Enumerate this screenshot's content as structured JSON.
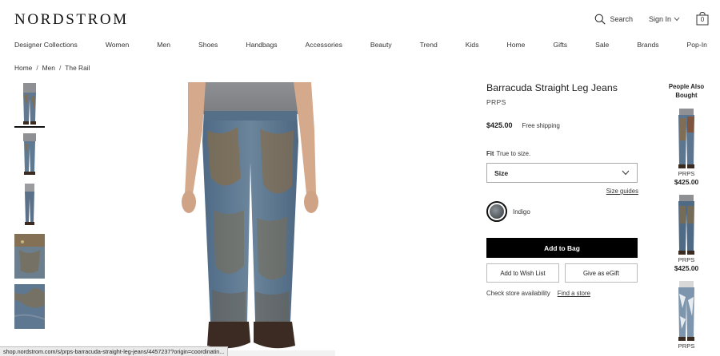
{
  "header": {
    "logo": "NORDSTROM",
    "search_label": "Search",
    "signin_label": "Sign In",
    "bag_count": "0"
  },
  "nav": [
    "Designer Collections",
    "Women",
    "Men",
    "Shoes",
    "Handbags",
    "Accessories",
    "Beauty",
    "Trend",
    "Kids",
    "Home",
    "Gifts",
    "Sale",
    "Brands",
    "Pop-In"
  ],
  "breadcrumb": [
    "Home",
    "Men",
    "The Rail"
  ],
  "product": {
    "title": "Barracuda Straight Leg Jeans",
    "brand": "PRPS",
    "price": "$425.00",
    "shipping": "Free shipping",
    "fit_label": "Fit",
    "fit_value": "True to size.",
    "size_placeholder": "Size",
    "size_guides": "Size guides",
    "color": "Indigo",
    "add_to_bag": "Add to Bag",
    "wish_list": "Add to Wish List",
    "egift": "Give as eGift",
    "store_text": "Check store availability",
    "find_store": "Find a store"
  },
  "people_also_bought": {
    "title": "People Also Bought",
    "items": [
      {
        "brand": "PRPS",
        "price": "$425.00"
      },
      {
        "brand": "PRPS",
        "price": "$425.00"
      },
      {
        "brand": "PRPS"
      }
    ]
  },
  "status_url": "shop.nordstrom.com/s/prps-barracuda-straight-leg-jeans/4457237?origin=coordinatin...",
  "colors": {
    "denim": "#5f7a93",
    "mud": "#8b6b42",
    "accent": "#000000"
  }
}
